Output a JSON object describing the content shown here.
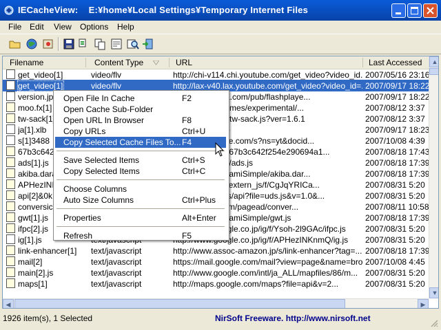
{
  "window": {
    "title": "IECacheView:    E:¥home¥Local Settings¥Temporary Internet Files"
  },
  "menubar": [
    "File",
    "Edit",
    "View",
    "Options",
    "Help"
  ],
  "toolbar_icons": [
    "folder-open-icon",
    "globe-icon",
    "refresh-cache-icon",
    "save-icon",
    "copy-icon",
    "copy-files-icon",
    "properties-icon",
    "find-icon",
    "exit-icon"
  ],
  "columns": [
    "Filename",
    "Content Type",
    "URL",
    "Last Accessed"
  ],
  "rows": [
    {
      "filename": "get_video[1]",
      "content_type": "video/flv",
      "url": "http://chi-v114.chi.youtube.com/get_video?video_id...",
      "last_accessed": "2007/05/16 23:16",
      "icon": "file",
      "selected": false
    },
    {
      "filename": "get_video[1]",
      "content_type": "video/flv",
      "url": "http://lax-v40.lax.youtube.com/get_video?video_id=...",
      "last_accessed": "2007/09/17 18:22",
      "icon": "file",
      "selected": true
    },
    {
      "filename": "version.jp",
      "content_type": "",
      "url": "od.macromedia.com/pub/flashplaye...",
      "last_accessed": "2007/09/17 18:22",
      "icon": "file",
      "selected": false
    },
    {
      "filename": "moo.fx[1]",
      "content_type": "",
      "url": "/wp-content/themes/experimental/...",
      "last_accessed": "2007/08/12 3:37",
      "icon": "js",
      "selected": false
    },
    {
      "filename": "tw-sack[1]",
      "content_type": "",
      "url": "/wp-includes/js/tw-sack.js?ver=1.6.1",
      "last_accessed": "2007/08/12 3:37",
      "icon": "js",
      "selected": false
    },
    {
      "filename": "ja[1].xlb",
      "content_type": "",
      "url": "e.com/xlb/ja.xlb",
      "last_accessed": "2007/09/17 18:23",
      "icon": "file",
      "selected": false
    },
    {
      "filename": "s[1]3488",
      "content_type": "",
      "url": "nts.video.google.com/s?ns=yt&docid...",
      "last_accessed": "2007/10/08 4:39",
      "icon": "file",
      "selected": false
    },
    {
      "filename": "67b3c642",
      "content_type": "",
      "url": "com/perl.net/js/67b3c642f254e290694a1...",
      "last_accessed": "2007/08/18 17:43",
      "icon": "js",
      "selected": false
    },
    {
      "filename": "ads[1].js",
      "content_type": "",
      "url": "oc-amazon.jp/s/ads.js",
      "last_accessed": "2007/08/18 17:39",
      "icon": "js",
      "selected": false
    },
    {
      "filename": "akiba.dara",
      "content_type": "",
      "url": "-akiba.com/DaramiSimple/akiba.dar...",
      "last_accessed": "2007/08/18 17:39",
      "icon": "js",
      "selected": false
    },
    {
      "filename": "APHezINI",
      "content_type": "",
      "url": "google.co.jp/ig/extern_js/f/CgJqYRICa...",
      "last_accessed": "2007/08/31 5:20",
      "icon": "js",
      "selected": false
    },
    {
      "filename": "api[2]&0k",
      "content_type": "",
      "url": "google.com/uds/api?file=uds.js&v=1.0&...",
      "last_accessed": "2007/08/31 5:20",
      "icon": "js",
      "selected": false
    },
    {
      "filename": "conversic",
      "content_type": "",
      "url": "eadservices.com/pagead/conver...",
      "last_accessed": "2007/08/11 10:58",
      "icon": "js",
      "selected": false
    },
    {
      "filename": "gwt[1].js",
      "content_type": "",
      "url": "-akiba.com/DaramiSimple/gwt.js",
      "last_accessed": "2007/08/18 17:39",
      "icon": "js",
      "selected": false
    },
    {
      "filename": "ifpc[2].js",
      "content_type": "text/javascript",
      "url": "http://www.google.co.jp/ig/f/Ysoh-2l9GAc/ifpc.js",
      "last_accessed": "2007/08/31 5:20",
      "icon": "js",
      "selected": false
    },
    {
      "filename": "ig[1].js",
      "content_type": "text/javascript",
      "url": "http://www.google.co.jp/ig/f/APHezINKnmQ/ig.js",
      "last_accessed": "2007/08/31 5:20",
      "icon": "file",
      "selected": false
    },
    {
      "filename": "link-enhancer[1]",
      "content_type": "text/javascript",
      "url": "http://www.assoc-amazon.jp/s/link-enhancer?tag=...",
      "last_accessed": "2007/08/18 17:39",
      "icon": "js",
      "selected": false
    },
    {
      "filename": "mail[2]",
      "content_type": "text/javascript",
      "url": "https://mail.google.com/mail?view=page&name=bro...",
      "last_accessed": "2007/10/08 4:45",
      "icon": "js",
      "selected": false
    },
    {
      "filename": "main[2].js",
      "content_type": "text/javascript",
      "url": "http://www.google.com/intl/ja_ALL/mapfiles/86/m...",
      "last_accessed": "2007/08/31 5:20",
      "icon": "js",
      "selected": false
    },
    {
      "filename": "maps[1]",
      "content_type": "text/javascript",
      "url": "http://maps.google.com/maps?file=api&v=2...",
      "last_accessed": "2007/08/31 5:20",
      "icon": "js",
      "selected": false
    }
  ],
  "context_menu": {
    "groups": [
      [
        {
          "label": "Open File In Cache",
          "shortcut": "F2",
          "highlighted": false
        },
        {
          "label": "Open Cache Sub-Folder",
          "shortcut": "",
          "highlighted": false
        },
        {
          "label": "Open URL In Browser",
          "shortcut": "F8",
          "highlighted": false
        },
        {
          "label": "Copy URLs",
          "shortcut": "Ctrl+U",
          "highlighted": false
        },
        {
          "label": "Copy Selected Cache Files To...",
          "shortcut": "F4",
          "highlighted": true
        }
      ],
      [
        {
          "label": "Save Selected Items",
          "shortcut": "Ctrl+S",
          "highlighted": false
        },
        {
          "label": "Copy Selected Items",
          "shortcut": "Ctrl+C",
          "highlighted": false
        }
      ],
      [
        {
          "label": "Choose Columns",
          "shortcut": "",
          "highlighted": false
        },
        {
          "label": "Auto Size Columns",
          "shortcut": "Ctrl+Plus",
          "highlighted": false
        }
      ],
      [
        {
          "label": "Properties",
          "shortcut": "Alt+Enter",
          "highlighted": false
        }
      ],
      [
        {
          "label": "Refresh",
          "shortcut": "F5",
          "highlighted": false
        }
      ]
    ]
  },
  "statusbar": {
    "items_text": "1926 item(s), 1 Selected",
    "credit_text": "NirSoft Freeware.  http://www.nirsoft.net"
  },
  "colors": {
    "title": "#0a5bd8",
    "selection": "#316ac5",
    "credit": "#00008b"
  }
}
